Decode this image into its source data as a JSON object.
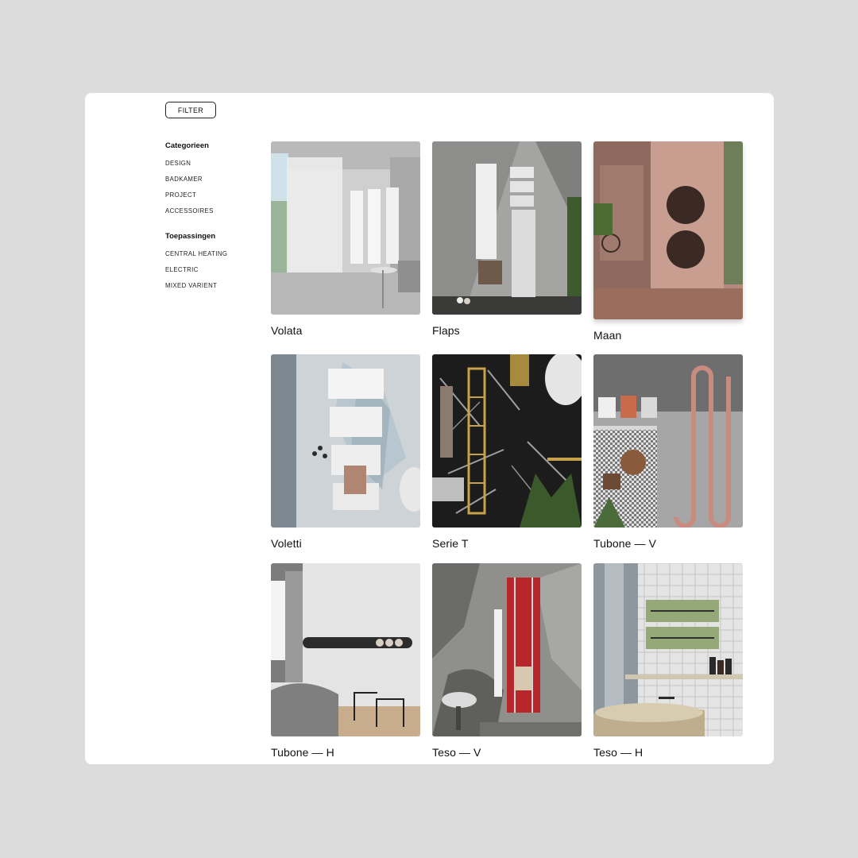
{
  "filter": {
    "label": "FILTER"
  },
  "sidebar": {
    "categories": {
      "heading": "Categorieen",
      "items": [
        "DESIGN",
        "BADKAMER",
        "PROJECT",
        "ACCESSOIRES"
      ]
    },
    "applications": {
      "heading": "Toepassingen",
      "items": [
        "CENTRAL HEATING",
        "ELECTRIC",
        "MIXED VARIENT"
      ]
    }
  },
  "products": [
    {
      "name": "Volata"
    },
    {
      "name": "Flaps"
    },
    {
      "name": "Maan"
    },
    {
      "name": "Voletti"
    },
    {
      "name": "Serie T"
    },
    {
      "name": "Tubone — V"
    },
    {
      "name": "Tubone — H"
    },
    {
      "name": "Teso — V"
    },
    {
      "name": "Teso — H"
    }
  ],
  "colors": {
    "page_bg": "#dcdcdc",
    "card_bg": "#ffffff",
    "text": "#111111"
  }
}
